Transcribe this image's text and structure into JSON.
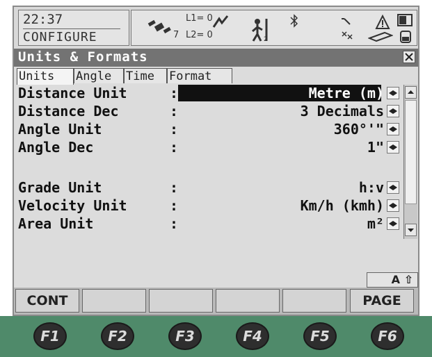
{
  "status": {
    "time": "22:37",
    "mode": "CONFIGURE",
    "l1": "L1= 0",
    "l2": "L2= 0",
    "sv_count": "7"
  },
  "window": {
    "title": "Units & Formats"
  },
  "tabs": [
    {
      "label": "Units",
      "active": true
    },
    {
      "label": "Angle",
      "active": false
    },
    {
      "label": "Time",
      "active": false
    },
    {
      "label": "Format",
      "active": false
    }
  ],
  "fields": [
    {
      "label": "Distance Unit",
      "colon": ":",
      "value": "Metre (m)",
      "selected": true
    },
    {
      "label": "Distance Dec",
      "colon": ":",
      "value": "3 Decimals"
    },
    {
      "label": "Angle Unit",
      "colon": ":",
      "value": "360°'\""
    },
    {
      "label": "Angle Dec",
      "colon": ":",
      "value": "1\""
    },
    {
      "label": "Grade Unit",
      "colon": ":",
      "value": "h:v"
    },
    {
      "label": "Velocity Unit",
      "colon": ":",
      "value": "Km/h (kmh)"
    },
    {
      "label": "Area Unit",
      "colon": ":",
      "value": "m²"
    }
  ],
  "shift_indicator": "A ⇧",
  "softkeys": [
    "CONT",
    "",
    "",
    "",
    "",
    "PAGE"
  ],
  "function_keys": [
    "F1",
    "F2",
    "F3",
    "F4",
    "F5",
    "F6"
  ],
  "colors": {
    "screen_bg": "#dcdcdc",
    "title_bar": "#737373",
    "selection": "#111111",
    "fkey_bar": "#4f8a6a"
  }
}
